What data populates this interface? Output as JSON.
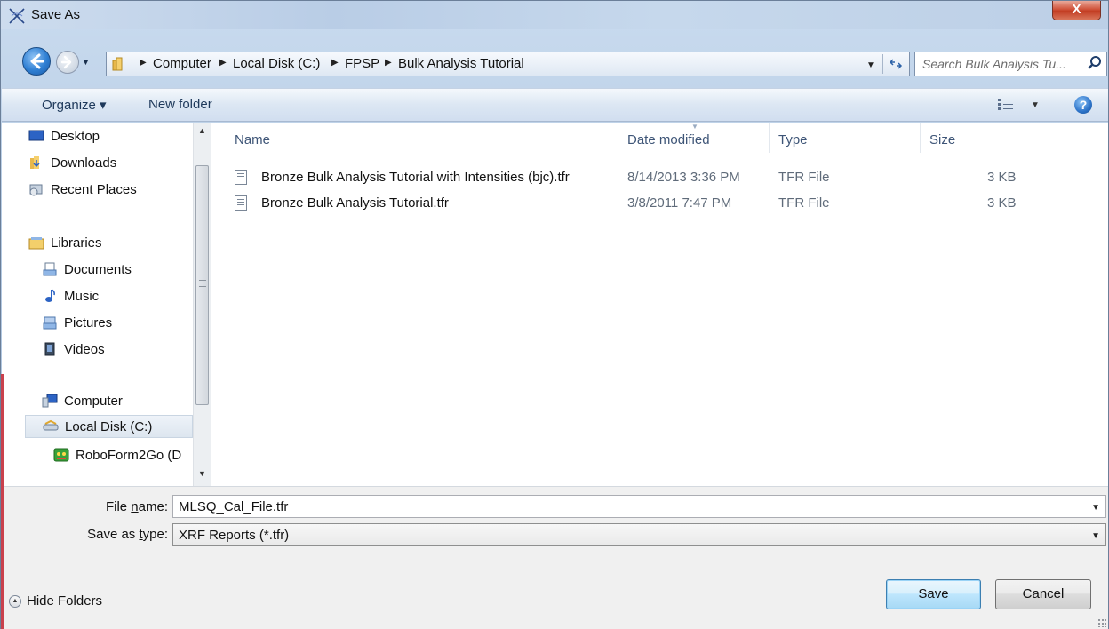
{
  "window": {
    "title": "Save As",
    "close_label": "X"
  },
  "address": {
    "crumbs": [
      "Computer",
      "Local Disk (C:)",
      "FPSP",
      "Bulk Analysis Tutorial"
    ]
  },
  "search": {
    "placeholder": "Search Bulk Analysis Tu..."
  },
  "toolbar": {
    "organize_label": "Organize ▾",
    "new_folder_label": "New folder",
    "help_label": "?"
  },
  "nav_pane": {
    "items": [
      {
        "label": "Desktop",
        "icon": "desktop-icon"
      },
      {
        "label": "Downloads",
        "icon": "downloads-folder-icon"
      },
      {
        "label": "Recent Places",
        "icon": "recent-places-icon"
      },
      {
        "label": "Libraries",
        "icon": "libraries-icon"
      },
      {
        "label": "Documents",
        "icon": "documents-icon"
      },
      {
        "label": "Music",
        "icon": "music-icon"
      },
      {
        "label": "Pictures",
        "icon": "pictures-icon"
      },
      {
        "label": "Videos",
        "icon": "videos-icon"
      },
      {
        "label": "Computer",
        "icon": "computer-icon"
      },
      {
        "label": "Local Disk (C:)",
        "icon": "local-disk-icon"
      },
      {
        "label": "RoboForm2Go (D",
        "icon": "roboform-drive-icon"
      }
    ]
  },
  "file_list": {
    "columns": [
      "Name",
      "Date modified",
      "Type",
      "Size"
    ],
    "rows": [
      {
        "name": "Bronze Bulk Analysis Tutorial with Intensities (bjc).tfr",
        "date": "8/14/2013 3:36 PM",
        "type": "TFR File",
        "size": "3 KB"
      },
      {
        "name": "Bronze Bulk Analysis Tutorial.tfr",
        "date": "3/8/2011 7:47 PM",
        "type": "TFR File",
        "size": "3 KB"
      }
    ]
  },
  "form": {
    "file_name_label_pre": "File ",
    "file_name_label_u": "n",
    "file_name_label_post": "ame:",
    "file_name_value": "MLSQ_Cal_File.tfr",
    "save_type_label_pre": "Save as ",
    "save_type_label_u": "t",
    "save_type_label_post": "ype:",
    "save_type_value": "XRF Reports (*.tfr)"
  },
  "footer": {
    "hide_folders_label": "Hide Folders",
    "save_label": "Save",
    "cancel_label": "Cancel"
  },
  "colors": {
    "accent": "#3c7fb1",
    "close_button": "#c23d22",
    "header_text": "#3e5577"
  }
}
